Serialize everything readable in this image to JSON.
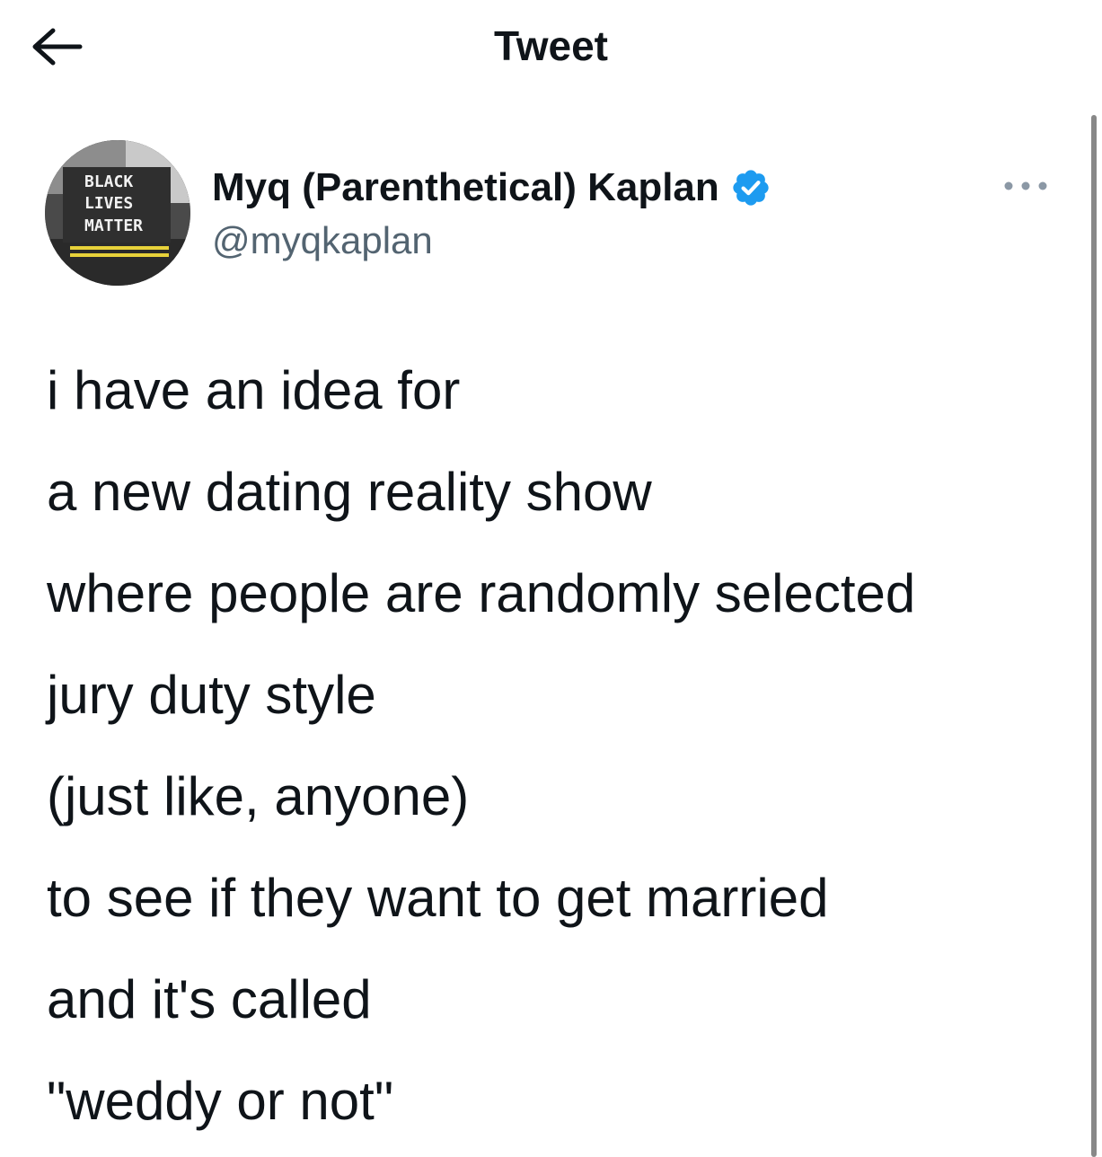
{
  "header": {
    "title": "Tweet",
    "back_icon": "arrow-left-icon"
  },
  "author": {
    "display_name": "Myq (Parenthetical) Kaplan",
    "handle": "@myqkaplan",
    "verified_icon": "verified-badge-icon",
    "avatar_text": [
      "BLACK",
      "LIVES",
      "MATTER"
    ],
    "more_icon": "more-options-icon"
  },
  "tweet": {
    "lines": [
      "i have an idea for",
      "a new dating reality show",
      "where people are randomly selected",
      "jury duty style",
      "(just like, anyone)",
      "to see if they want to get married",
      "and it's called",
      "\"weddy or not\""
    ]
  },
  "colors": {
    "text": "#0f1419",
    "secondary_text": "#536471",
    "verified_blue": "#1d9bf0"
  }
}
